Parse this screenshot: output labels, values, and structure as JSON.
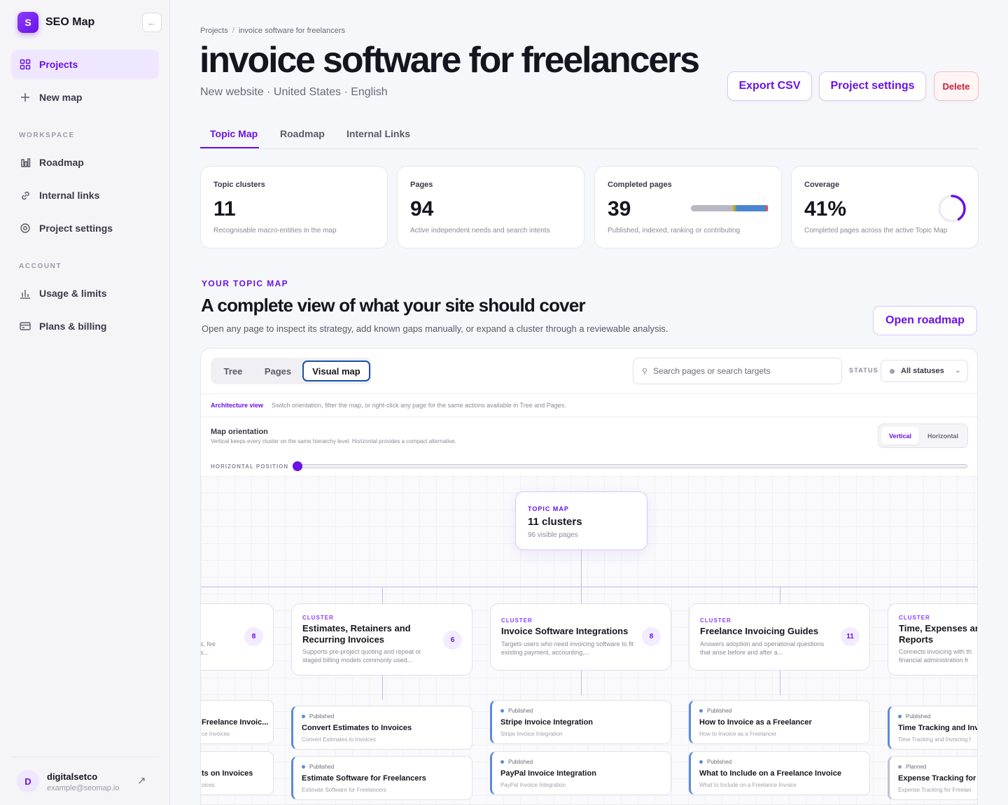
{
  "brand": {
    "logo_letter": "S",
    "name": "SEO Map"
  },
  "sidebar": {
    "nav_top": [
      {
        "label": "Projects"
      },
      {
        "label": "New map"
      }
    ],
    "workspace_label": "WORKSPACE",
    "workspace": [
      {
        "label": "Roadmap"
      },
      {
        "label": "Internal links"
      },
      {
        "label": "Project settings"
      }
    ],
    "account_label": "ACCOUNT",
    "account": [
      {
        "label": "Usage & limits"
      },
      {
        "label": "Plans & billing"
      }
    ],
    "user": {
      "initial": "D",
      "name": "digitalsetco",
      "email": "example@seomap.io"
    }
  },
  "breadcrumb": {
    "root": "Projects",
    "sep": "/",
    "current": "invoice software for freelancers"
  },
  "header": {
    "title": "invoice software for freelancers",
    "subtitle": "New website · United States · English",
    "export_label": "Export CSV",
    "settings_label": "Project settings",
    "delete_label": "Delete"
  },
  "tabs": [
    {
      "label": "Topic Map"
    },
    {
      "label": "Roadmap"
    },
    {
      "label": "Internal Links"
    }
  ],
  "stats": [
    {
      "label": "Topic clusters",
      "value": "11",
      "desc": "Recognisable macro-entities in the map"
    },
    {
      "label": "Pages",
      "value": "94",
      "desc": "Active independent needs and search intents"
    },
    {
      "label": "Completed pages",
      "value": "39",
      "desc": "Published, indexed, ranking or contributing"
    },
    {
      "label": "Coverage",
      "value": "41%",
      "desc": "Completed pages across the active Topic Map",
      "percent": 41
    }
  ],
  "colors": {
    "accent": "#6a11e6",
    "published": "#5b8bd8",
    "planned": "#a0a0ae",
    "danger": "#d0203a"
  },
  "section": {
    "eyebrow": "YOUR TOPIC MAP",
    "title": "A complete view of what your site should cover",
    "desc": "Open any page to inspect its strategy, add known gaps manually, or expand a cluster through a reviewable analysis.",
    "open_roadmap": "Open roadmap"
  },
  "panel": {
    "views": [
      {
        "label": "Tree"
      },
      {
        "label": "Pages"
      },
      {
        "label": "Visual map"
      }
    ],
    "search_placeholder": "Search pages or search targets",
    "status_label": "STATUS",
    "status_value": "All statuses",
    "arch_title": "Architecture view",
    "arch_desc": "Switch orientation, filter the map, or right-click any page for the same actions available in Tree and Pages.",
    "orient_title": "Map orientation",
    "orient_desc": "Vertical keeps every cluster on the same hierarchy level. Horizontal provides a compact alternative.",
    "orientations": [
      {
        "label": "Vertical"
      },
      {
        "label": "Horizontal"
      }
    ],
    "position_label": "HORIZONTAL POSITION",
    "position_value": 0
  },
  "map": {
    "root": {
      "eyebrow": "TOPIC MAP",
      "title": "11 clusters",
      "sub": "96 visible pages"
    },
    "clusters": [
      {
        "eyebrow": "CLUSTER",
        "title": "ts",
        "desc": "ods, fee nes...",
        "count": "8"
      },
      {
        "eyebrow": "CLUSTER",
        "title": "Estimates, Retainers and Recurring Invoices",
        "desc": "Supports pre-project quoting and repeat or staged billing models commonly used...",
        "count": "6"
      },
      {
        "eyebrow": "CLUSTER",
        "title": "Invoice Software Integrations",
        "desc": "Targets users who need invoicing software to fit existing payment, accounting,...",
        "count": "8"
      },
      {
        "eyebrow": "CLUSTER",
        "title": "Freelance Invoicing Guides",
        "desc": "Answers adoption and operational questions that arise before and after a...",
        "count": "11"
      },
      {
        "eyebrow": "CLUSTER",
        "title": "Time, Expenses an Reports",
        "desc": "Connects invoicing with th financial administration fr",
        "count": ""
      }
    ],
    "pages": [
      [
        {
          "status": "",
          "title": "Freelance Invoic...",
          "sub": "ce Invoices"
        },
        {
          "status": "",
          "title": "ts on Invoices",
          "sub": "oices"
        }
      ],
      [
        {
          "status": "Published",
          "title": "Convert Estimates to Invoices",
          "sub": "Convert Estimates to Invoices"
        },
        {
          "status": "Published",
          "title": "Estimate Software for Freelancers",
          "sub": "Estimate Software for Freelancers"
        }
      ],
      [
        {
          "status": "Published",
          "title": "Stripe Invoice Integration",
          "sub": "Stripe Invoice Integration"
        },
        {
          "status": "Published",
          "title": "PayPal Invoice Integration",
          "sub": "PayPal Invoice Integration"
        }
      ],
      [
        {
          "status": "Published",
          "title": "How to Invoice as a Freelancer",
          "sub": "How to Invoice as a Freelancer"
        },
        {
          "status": "Published",
          "title": "What to Include on a Freelance Invoice",
          "sub": "What to Include on a Freelance Invoice"
        }
      ],
      [
        {
          "status": "Published",
          "title": "Time Tracking and Invo",
          "sub": "Time Tracking and Invoicing f"
        },
        {
          "status": "Planned",
          "title": "Expense Tracking for F",
          "sub": "Expense Tracking for Freelan"
        }
      ]
    ]
  }
}
